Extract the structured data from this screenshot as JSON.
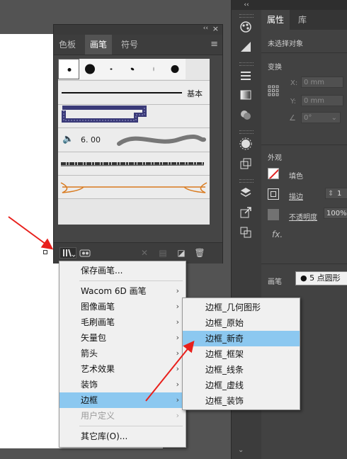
{
  "dock": {
    "collapse_glyph": "‹‹"
  },
  "brushes_panel": {
    "title_collapse": "‹‹",
    "title_close": "×",
    "tabs": [
      "色板",
      "画笔",
      "符号"
    ],
    "active_tab": "画笔",
    "menu_glyph": "≡",
    "basic_label": "基本",
    "calligraphic_size": "6. 00"
  },
  "properties": {
    "tabs": [
      "属性",
      "库"
    ],
    "no_selection": "未选择对象",
    "transform": "变换",
    "x_label": "X:",
    "y_label": "Y:",
    "x_value": "0 mm",
    "y_value": "0 mm",
    "angle_value": "0°",
    "appearance": "外观",
    "fill": "填色",
    "stroke": "描边",
    "stroke_value": "1",
    "opacity": "不透明度",
    "opacity_value": "100%",
    "fx": "fx.",
    "brush_label": "画笔",
    "brush_value": "5 点圆形"
  },
  "library_menu": {
    "items": [
      "保存画笔...",
      "Wacom 6D 画笔",
      "图像画笔",
      "毛刷画笔",
      "矢量包",
      "箭头",
      "艺术效果",
      "装饰",
      "边框",
      "用户定义",
      "其它库(O)..."
    ],
    "arrow": "›"
  },
  "border_submenu": {
    "items": [
      "边框_几何图形",
      "边框_原始",
      "边框_新奇",
      "边框_框架",
      "边框_线条",
      "边框_虚线",
      "边框_装饰"
    ]
  },
  "colors": {
    "highlight": "#8cc8f0",
    "annotation_arrow": "#e8201c",
    "panel_bg": "#454545"
  }
}
